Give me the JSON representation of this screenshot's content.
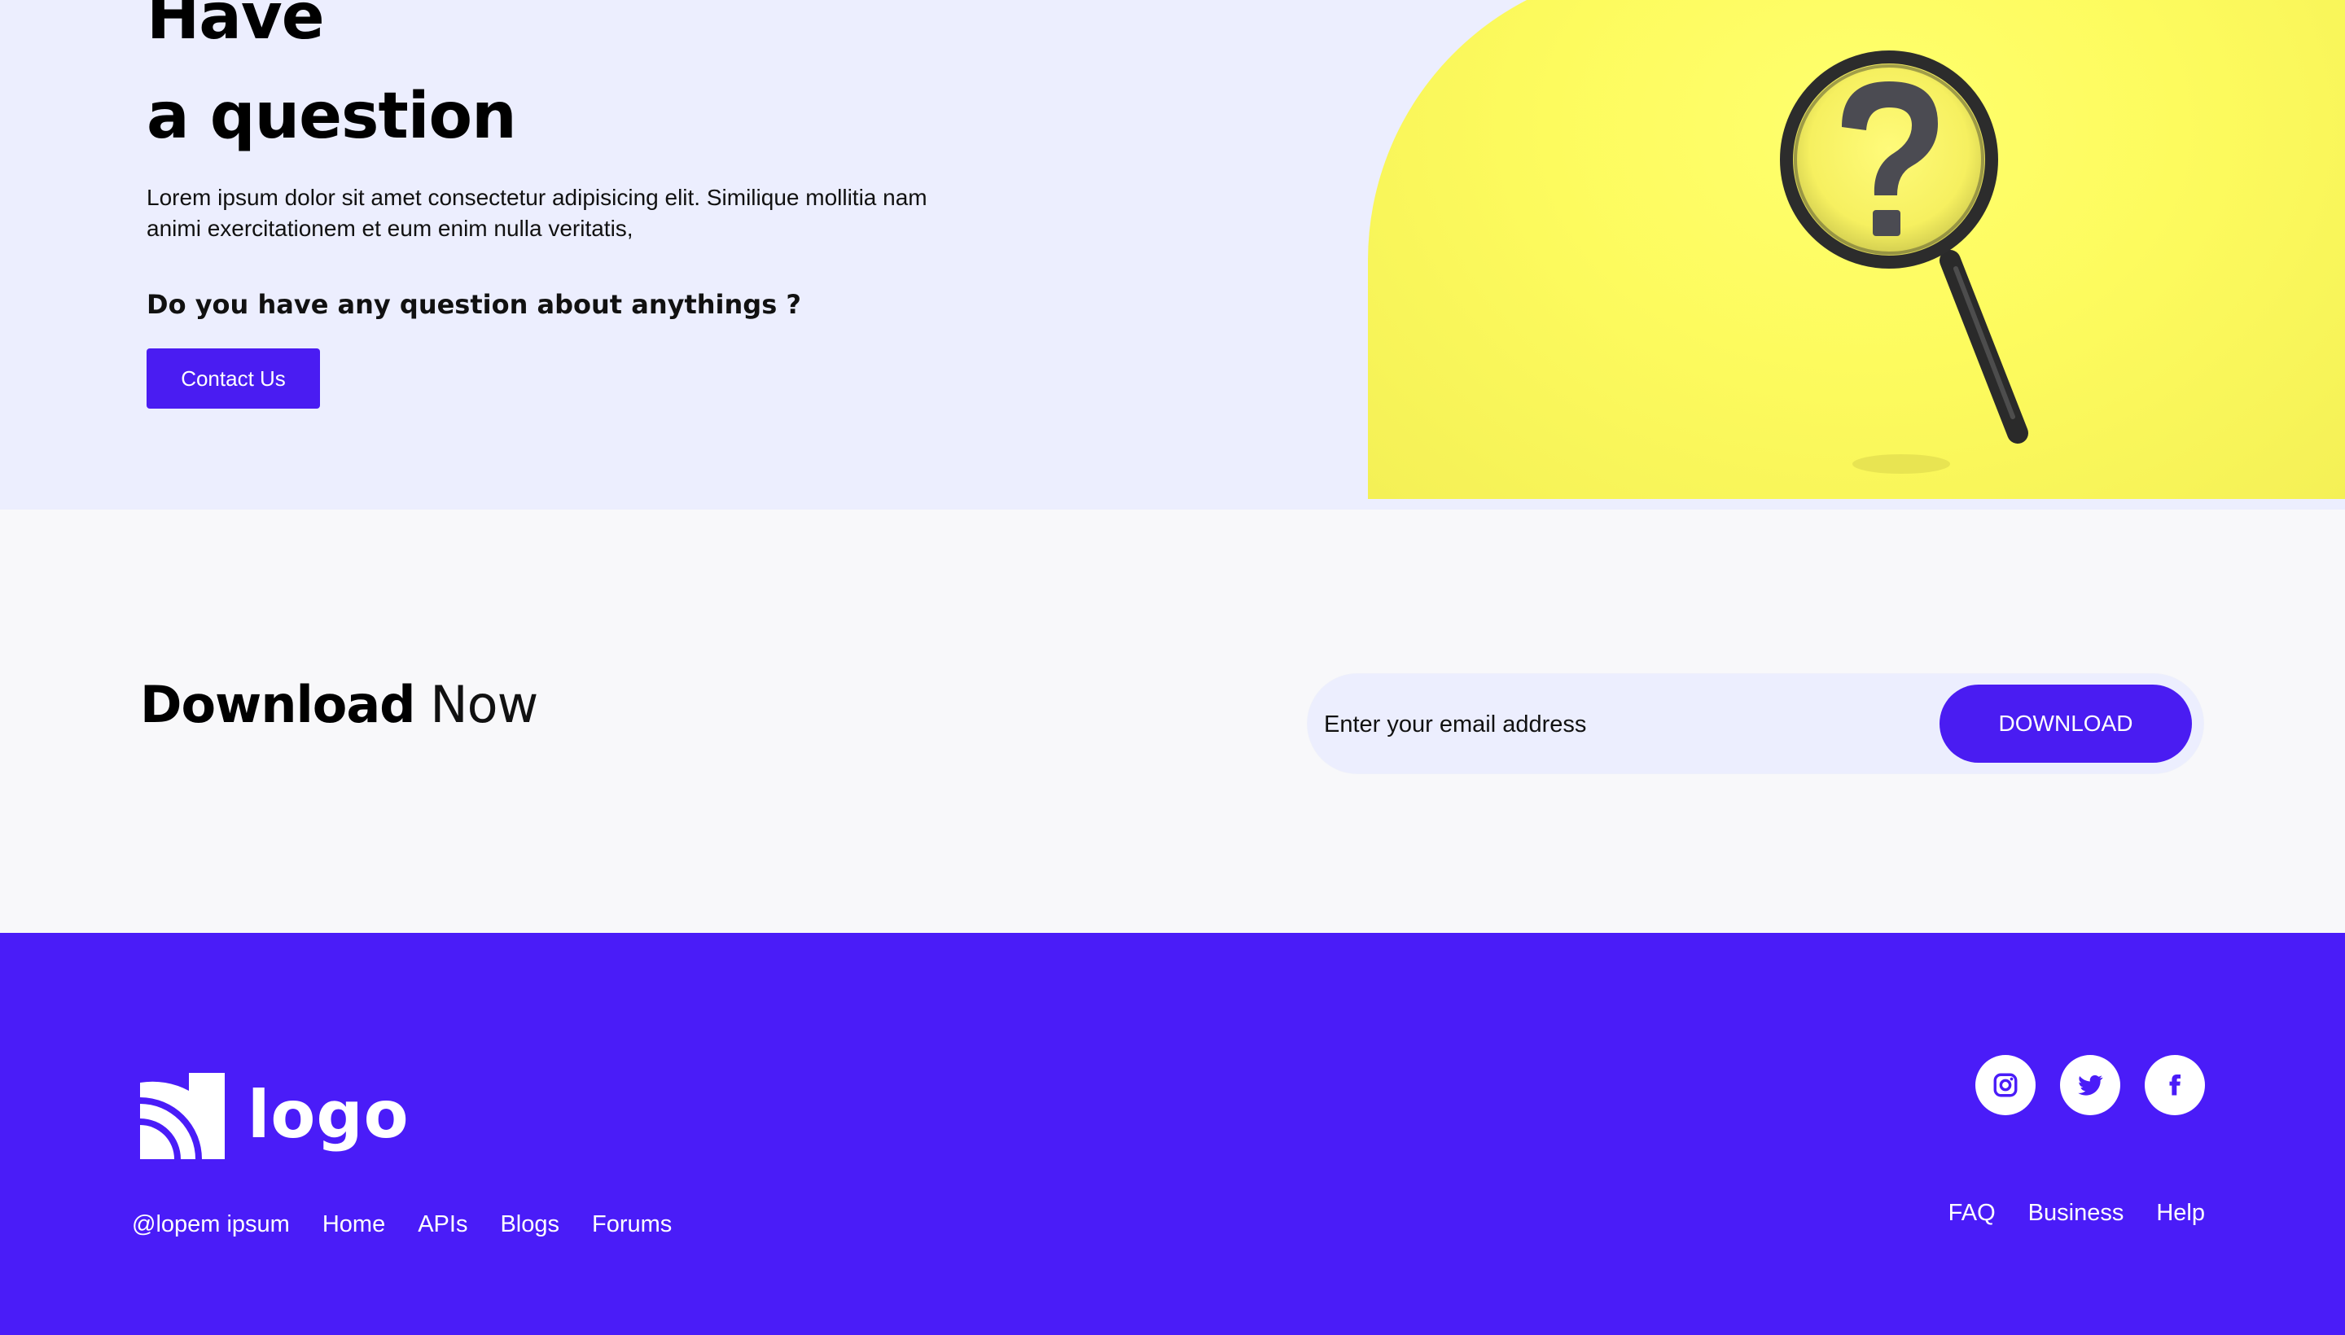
{
  "question": {
    "title_line1": "Have",
    "title_line2": "a question",
    "body": "Lorem ipsum dolor sit amet consectetur adipisicing elit. Similique mollitia nam animi exercitationem et eum enim nulla veritatis,",
    "prompt": "Do you have any question about anythings ?",
    "contact_label": "Contact Us"
  },
  "download": {
    "heading_strong": "Download",
    "heading_light": "Now",
    "email_placeholder": "Enter your email address",
    "button_label": "DOWNLOAD"
  },
  "footer": {
    "logo_text": "logo",
    "left_links": [
      "@lopem ipsum",
      "Home",
      "APIs",
      "Blogs",
      "Forums"
    ],
    "right_links": [
      "FAQ",
      "Business",
      "Help"
    ],
    "social": [
      "instagram-icon",
      "twitter-icon",
      "facebook-icon"
    ]
  },
  "colors": {
    "accent": "#4a1cf2",
    "hero_bg": "#eceefe",
    "page_bg": "#f8f8fa",
    "footer_bg": "#4a1cf8",
    "image_yellow": "#fdfb5e"
  }
}
